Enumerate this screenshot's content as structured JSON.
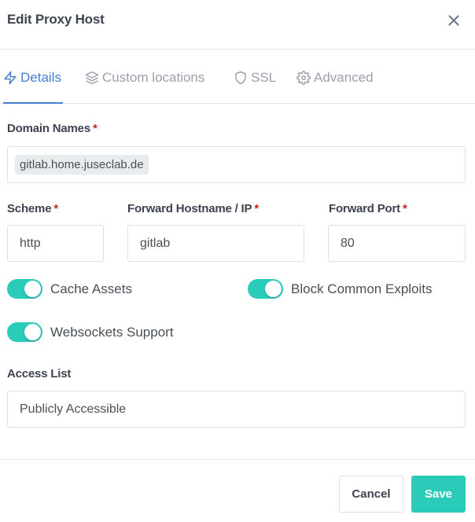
{
  "modal": {
    "title": "Edit Proxy Host",
    "close_icon": "close-icon"
  },
  "tabs": [
    {
      "label": "Details",
      "icon": "zap-icon",
      "active": true
    },
    {
      "label": "Custom locations",
      "icon": "layers-icon",
      "active": false
    },
    {
      "label": "SSL",
      "icon": "shield-icon",
      "active": false
    },
    {
      "label": "Advanced",
      "icon": "gear-icon",
      "active": false
    }
  ],
  "form": {
    "domain_names": {
      "label": "Domain Names",
      "required_mark": "*",
      "values": [
        "gitlab.home.juseclab.de"
      ]
    },
    "scheme": {
      "label": "Scheme",
      "required_mark": "*",
      "value": "http"
    },
    "forward_hostname": {
      "label": "Forward Hostname / IP",
      "required_mark": "*",
      "value": "gitlab"
    },
    "forward_port": {
      "label": "Forward Port",
      "required_mark": "*",
      "value": "80"
    },
    "toggles": [
      {
        "label": "Cache Assets",
        "checked": true
      },
      {
        "label": "Block Common Exploits",
        "checked": true
      },
      {
        "label": "Websockets Support",
        "checked": true
      }
    ],
    "access_list": {
      "label": "Access List",
      "value": "Publicly Accessible"
    }
  },
  "footer": {
    "cancel_label": "Cancel",
    "save_label": "Save"
  },
  "colors": {
    "accent": "#467fcf",
    "toggle_on": "#2bcbba",
    "save_button": "#2bcbba",
    "required": "#cd201f"
  }
}
